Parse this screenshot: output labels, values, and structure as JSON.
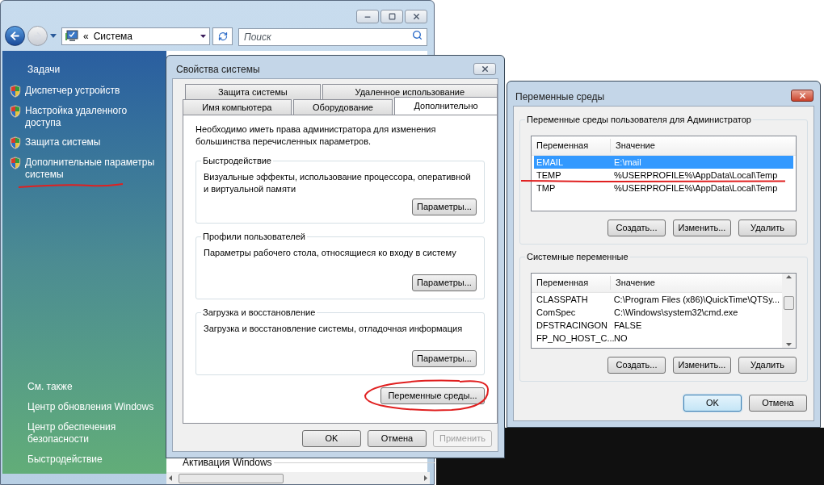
{
  "explorer": {
    "address": {
      "chevron": "«",
      "location": "Система"
    },
    "search": {
      "placeholder": "Поиск"
    },
    "tasks": {
      "heading": "Задачи",
      "items": [
        "Диспетчер устройств",
        "Настройка удаленного доступа",
        "Защита системы",
        "Дополнительные параметры системы"
      ]
    },
    "see_also": {
      "heading": "См. также",
      "items": [
        "Центр обновления Windows",
        "Центр обеспечения безопасности",
        "Быстродействие"
      ]
    },
    "content_partial": "Активация Windows"
  },
  "system_properties": {
    "title": "Свойства системы",
    "tab_rows": [
      [
        {
          "label": "Защита системы",
          "selected": false
        },
        {
          "label": "Удаленное использование",
          "selected": false
        }
      ],
      [
        {
          "label": "Имя компьютера",
          "selected": false
        },
        {
          "label": "Оборудование",
          "selected": false
        },
        {
          "label": "Дополнительно",
          "selected": true
        }
      ]
    ],
    "note": "Необходимо иметь права администратора для изменения большинства перечисленных параметров.",
    "groups": [
      {
        "title": "Быстродействие",
        "description": "Визуальные эффекты, использование процессора, оперативной и виртуальной памяти",
        "button": "Параметры..."
      },
      {
        "title": "Профили пользователей",
        "description": "Параметры рабочего стола, относящиеся ко входу в систему",
        "button": "Параметры..."
      },
      {
        "title": "Загрузка и восстановление",
        "description": "Загрузка и восстановление системы, отладочная информация",
        "button": "Параметры..."
      }
    ],
    "env_button": "Переменные среды...",
    "buttons": [
      {
        "label": "OK",
        "disabled": false
      },
      {
        "label": "Отмена",
        "disabled": false
      },
      {
        "label": "Применить",
        "disabled": true
      }
    ]
  },
  "env_dialog": {
    "title": "Переменные среды",
    "user_group": {
      "title": "Переменные среды пользователя для Администратор",
      "columns": [
        "Переменная",
        "Значение"
      ],
      "rows": [
        {
          "variable": "EMAIL",
          "value": "E:\\mail",
          "selected": true
        },
        {
          "variable": "TEMP",
          "value": "%USERPROFILE%\\AppData\\Local\\Temp",
          "selected": false
        },
        {
          "variable": "TMP",
          "value": "%USERPROFILE%\\AppData\\Local\\Temp",
          "selected": false
        }
      ],
      "buttons": [
        "Создать...",
        "Изменить...",
        "Удалить"
      ]
    },
    "system_group": {
      "title": "Системные переменные",
      "columns": [
        "Переменная",
        "Значение"
      ],
      "rows": [
        {
          "variable": "CLASSPATH",
          "value": "C:\\Program Files (x86)\\QuickTime\\QTSy...",
          "selected": false
        },
        {
          "variable": "ComSpec",
          "value": "C:\\Windows\\system32\\cmd.exe",
          "selected": false
        },
        {
          "variable": "DFSTRACINGON",
          "value": "FALSE",
          "selected": false
        },
        {
          "variable": "FP_NO_HOST_C...",
          "value": "NO",
          "selected": false
        }
      ],
      "buttons": [
        "Создать...",
        "Изменить...",
        "Удалить"
      ]
    },
    "buttons": [
      {
        "label": "OK",
        "default": true
      },
      {
        "label": "Отмена",
        "default": false
      }
    ]
  }
}
